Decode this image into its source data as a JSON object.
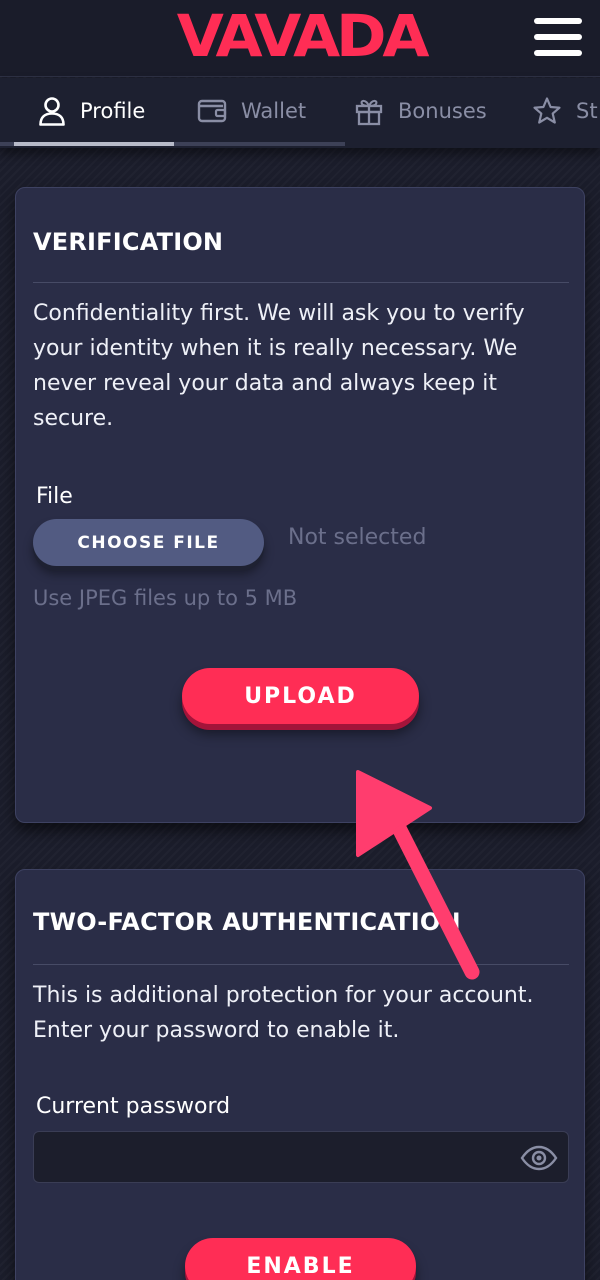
{
  "header": {
    "logo_text": "VAVADA",
    "brand_color": "#ff2d55",
    "menu_icon": "hamburger-menu-icon"
  },
  "tabs": [
    {
      "label": "Profile",
      "icon": "user-icon",
      "active": true
    },
    {
      "label": "Wallet",
      "icon": "wallet-icon",
      "active": false
    },
    {
      "label": "Bonuses",
      "icon": "gift-icon",
      "active": false
    },
    {
      "label": "St",
      "icon": "star-icon",
      "active": false
    }
  ],
  "verification": {
    "title": "VERIFICATION",
    "description": "Confidentiality first. We will ask you to verify your identity when it is really necessary. We never reveal your data and always keep it secure.",
    "file_label": "File",
    "choose_file_label": "CHOOSE FILE",
    "file_status": "Not selected",
    "hint": "Use JPEG files up to 5 MB",
    "upload_label": "UPLOAD"
  },
  "two_factor": {
    "title": "TWO-FACTOR AUTHENTICATION",
    "description": "This is additional protection for your account. Enter your password to enable it.",
    "password_label": "Current password",
    "password_value": "",
    "enable_label": "ENABLE"
  },
  "colors": {
    "background": "#1b1d2b",
    "card": "#2a2d47",
    "accent": "#ff2d55",
    "secondary_button": "#525b82",
    "annotation_arrow": "#ff3d6e"
  }
}
